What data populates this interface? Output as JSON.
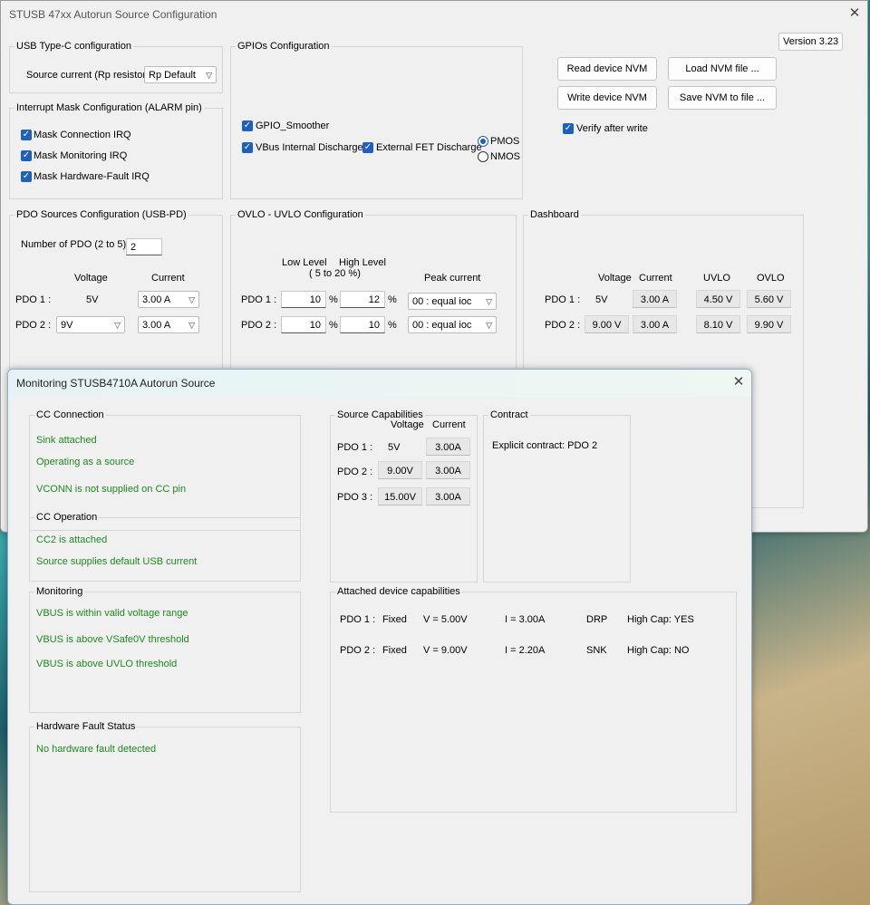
{
  "main": {
    "title": "STUSB 47xx Autorun Source Configuration",
    "version": "Version 3.23",
    "usbc": {
      "group": "USB Type-C configuration",
      "source_current_label": "Source current (Rp resistor)",
      "source_current_value": "Rp Default"
    },
    "irq": {
      "group": "Interrupt Mask Configuration (ALARM pin)",
      "items": [
        "Mask Connection IRQ",
        "Mask Monitoring IRQ",
        "Mask Hardware-Fault IRQ"
      ]
    },
    "gpio": {
      "group": "GPIOs Configuration",
      "smoother": "GPIO_Smoother",
      "vbus_discharge": "VBus Internal Discharge",
      "ext_fet": "External FET Discharge",
      "pmos": "PMOS",
      "nmos": "NMOS"
    },
    "buttons": {
      "read": "Read device NVM",
      "load": "Load NVM file ...",
      "write": "Write device NVM",
      "save": "Save NVM to file ...",
      "verify": "Verify after write"
    },
    "pdo": {
      "group": "PDO Sources Configuration (USB-PD)",
      "num_label": "Number of PDO (2 to 5)",
      "num_value": "2",
      "voltage_hdr": "Voltage",
      "current_hdr": "Current",
      "rows": [
        {
          "label": "PDO 1 :",
          "voltage": "5V",
          "current": "3.00 A"
        },
        {
          "label": "PDO 2 :",
          "voltage": "9V",
          "current": "3.00 A"
        }
      ]
    },
    "ovlo": {
      "group": "OVLO - UVLO Configuration",
      "low_hdr": "Low Level",
      "high_hdr": "High Level",
      "range_hdr": "( 5 to 20 %)",
      "peak_hdr": "Peak current",
      "pct": "%",
      "rows": [
        {
          "label": "PDO 1 :",
          "low": "10",
          "high": "12",
          "peak": "00 : equal ioc"
        },
        {
          "label": "PDO 2 :",
          "low": "10",
          "high": "10",
          "peak": "00 : equal ioc"
        }
      ]
    },
    "dashboard": {
      "group": "Dashboard",
      "headers": [
        "Voltage",
        "Current",
        "UVLO",
        "OVLO"
      ],
      "rows": [
        {
          "label": "PDO 1 :",
          "voltage": "5V",
          "current": "3.00 A",
          "uvlo": "4.50 V",
          "ovlo": "5.60 V"
        },
        {
          "label": "PDO 2 :",
          "voltage": "9.00 V",
          "current": "3.00 A",
          "uvlo": "8.10 V",
          "ovlo": "9.90 V"
        }
      ]
    }
  },
  "monitor": {
    "title": "Monitoring STUSB4710A Autorun Source",
    "cc_conn": {
      "group": "CC Connection",
      "lines": [
        "Sink attached",
        "Operating as a source",
        "VCONN is not supplied on CC pin"
      ]
    },
    "cc_op": {
      "group": "CC Operation",
      "lines": [
        "CC2 is attached",
        "Source supplies default USB current"
      ]
    },
    "monitoring": {
      "group": "Monitoring",
      "lines": [
        "VBUS is within valid voltage range",
        "VBUS is above VSafe0V threshold",
        "VBUS is above UVLO threshold"
      ]
    },
    "hw_fault": {
      "group": "Hardware Fault Status",
      "line": "No hardware fault detected"
    },
    "src_caps": {
      "group": "Source Capabilities",
      "voltage_hdr": "Voltage",
      "current_hdr": "Current",
      "rows": [
        {
          "label": "PDO 1 :",
          "voltage": "5V",
          "current": "3.00A"
        },
        {
          "label": "PDO 2 :",
          "voltage": "9.00V",
          "current": "3.00A"
        },
        {
          "label": "PDO 3 :",
          "voltage": "15.00V",
          "current": "3.00A"
        }
      ]
    },
    "contract": {
      "group": "Contract",
      "text": "Explicit contract: PDO 2"
    },
    "attached": {
      "group": "Attached device capabilities",
      "rows": [
        {
          "label": "PDO 1 :",
          "type": "Fixed",
          "v": "V = 5.00V",
          "i": "I = 3.00A",
          "role": "DRP",
          "cap": "High Cap: YES"
        },
        {
          "label": "PDO 2 :",
          "type": "Fixed",
          "v": "V = 9.00V",
          "i": "I = 2.20A",
          "role": "SNK",
          "cap": "High Cap: NO"
        }
      ]
    }
  }
}
